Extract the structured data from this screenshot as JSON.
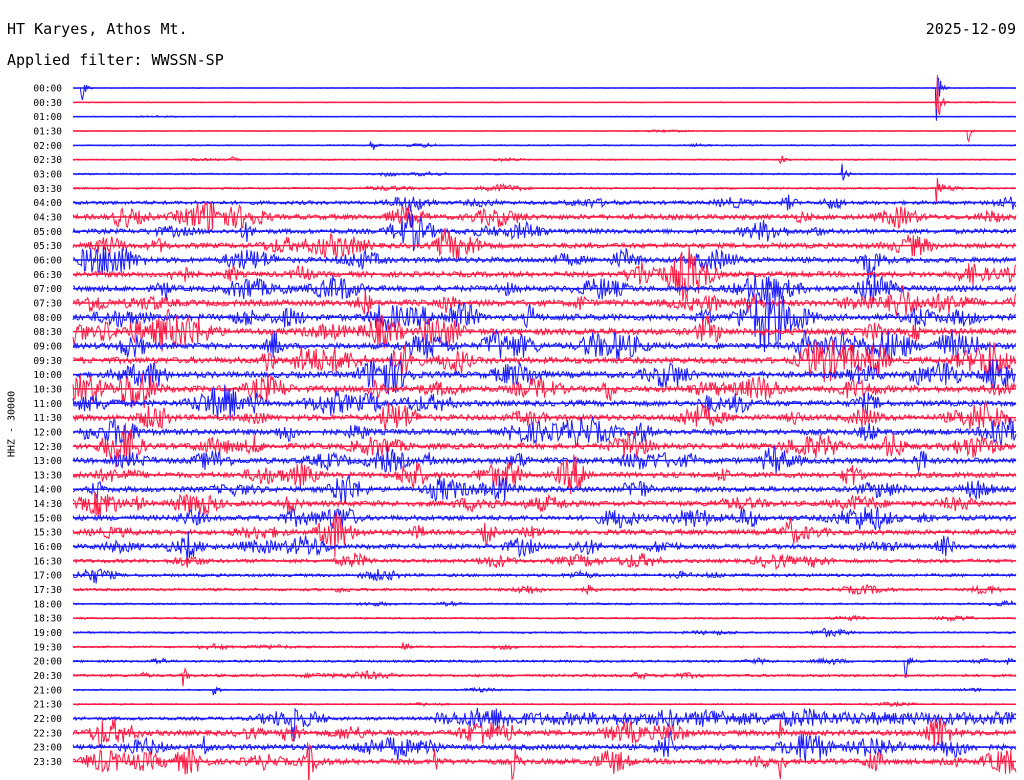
{
  "header": {
    "station": "HT Karyes, Athos Mt.",
    "filter": "Applied filter: WWSSN-SP",
    "date": "2025-12-09",
    "channel": "HHZ - 30000"
  },
  "colors": {
    "trace_a": "#1a1aff",
    "trace_b": "#ff1a44",
    "background": "#ffffff"
  },
  "chart_data": {
    "type": "line",
    "plot_kind": "helicorder",
    "title": "HT Karyes, Athos Mt.",
    "subtitle": "Applied filter: WWSSN-SP",
    "ylabel": "HHZ - 30000",
    "minutes_per_line": 30,
    "row_labels": [
      "00:00",
      "00:30",
      "01:00",
      "01:30",
      "02:00",
      "02:30",
      "03:00",
      "03:30",
      "04:00",
      "04:30",
      "05:00",
      "05:30",
      "06:00",
      "06:30",
      "07:00",
      "07:30",
      "08:00",
      "08:30",
      "09:00",
      "09:30",
      "10:00",
      "10:30",
      "11:00",
      "11:30",
      "12:00",
      "12:30",
      "13:00",
      "13:30",
      "14:00",
      "14:30",
      "15:00",
      "15:30",
      "16:00",
      "16:30",
      "17:00",
      "17:30",
      "18:00",
      "18:30",
      "19:00",
      "19:30",
      "20:00",
      "20:30",
      "21:00",
      "21:30",
      "22:00",
      "22:30",
      "23:00",
      "23:30"
    ],
    "noise_level": [
      0.3,
      0.4,
      0.5,
      0.6,
      1.0,
      1.2,
      1.5,
      2.0,
      4.5,
      6.5,
      6.0,
      6.5,
      7.0,
      7.0,
      7.5,
      8.0,
      8.5,
      8.5,
      8.0,
      8.0,
      8.0,
      8.0,
      7.5,
      7.5,
      7.5,
      7.5,
      7.5,
      7.0,
      7.0,
      7.0,
      6.5,
      6.5,
      6.0,
      4.5,
      3.5,
      3.0,
      1.8,
      1.8,
      1.8,
      2.0,
      2.5,
      3.0,
      1.2,
      1.2,
      4.0,
      7.0,
      7.0,
      7.0
    ],
    "row_colors": [
      "blue",
      "red"
    ],
    "events": [
      {
        "row": 0,
        "minute": 0.3,
        "amplitude": 18
      },
      {
        "row": 0,
        "minute": 27.5,
        "amplitude": 34
      },
      {
        "row": 1,
        "minute": 27.5,
        "amplitude": 28
      },
      {
        "row": 3,
        "minute": 28.5,
        "amplitude": 10
      },
      {
        "row": 4,
        "minute": 9.5,
        "amplitude": 8
      },
      {
        "row": 5,
        "minute": 5.0,
        "amplitude": 9
      },
      {
        "row": 5,
        "minute": 22.5,
        "amplitude": 8
      },
      {
        "row": 6,
        "minute": 24.5,
        "amplitude": 10
      },
      {
        "row": 7,
        "minute": 27.5,
        "amplitude": 14
      },
      {
        "row": 39,
        "minute": 10.5,
        "amplitude": 10
      },
      {
        "row": 40,
        "minute": 26.5,
        "amplitude": 16
      },
      {
        "row": 40,
        "minute": 29.7,
        "amplitude": 9
      },
      {
        "row": 41,
        "minute": 3.5,
        "amplitude": 12
      },
      {
        "row": 42,
        "minute": 4.5,
        "amplitude": 12
      },
      {
        "row": 44,
        "minute": 7.0,
        "amplitude": 30
      },
      {
        "row": 45,
        "minute": 22.5,
        "amplitude": 12
      },
      {
        "row": 46,
        "minute": 4.2,
        "amplitude": 10
      },
      {
        "row": 47,
        "minute": 7.5,
        "amplitude": 20
      },
      {
        "row": 47,
        "minute": 11.5,
        "amplitude": 14
      },
      {
        "row": 47,
        "minute": 14.0,
        "amplitude": 22
      },
      {
        "row": 47,
        "minute": 22.5,
        "amplitude": 20
      }
    ]
  }
}
